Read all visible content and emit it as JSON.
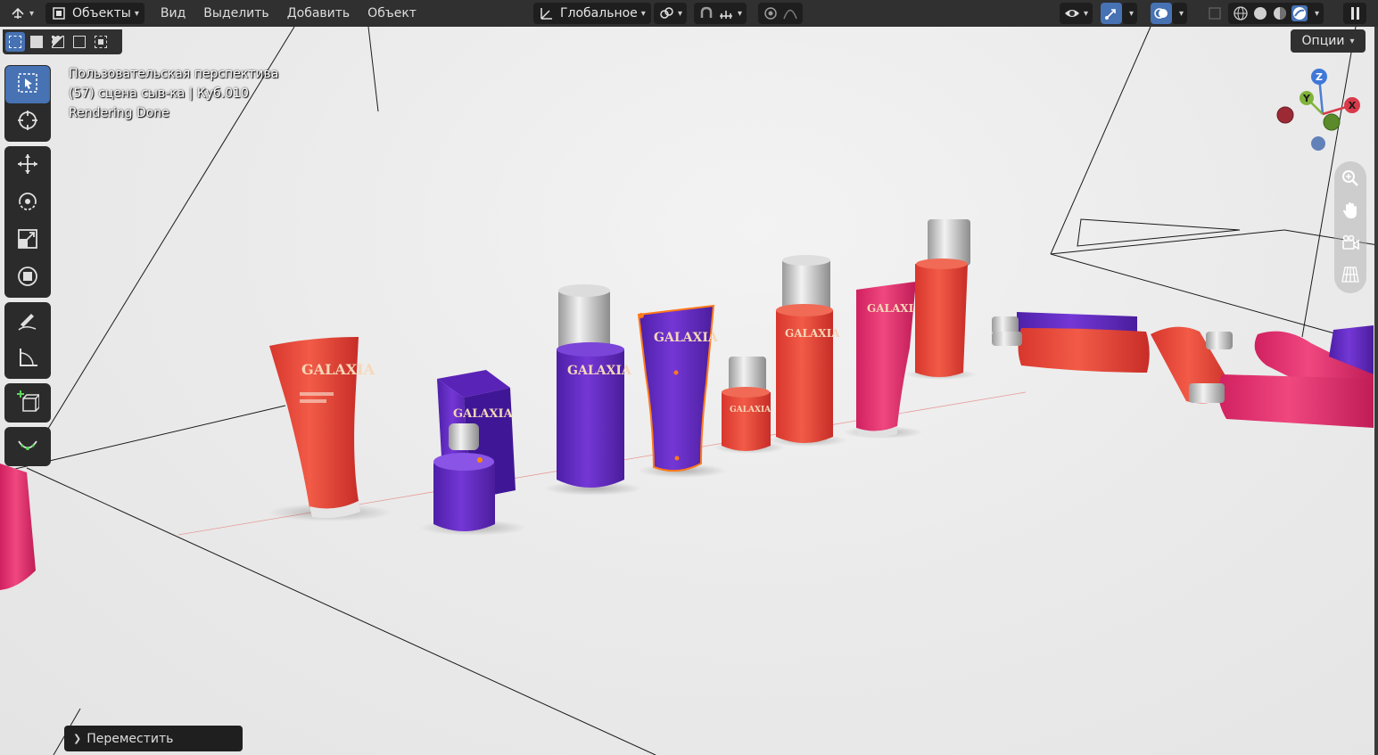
{
  "header": {
    "editor_type_icon": "editor-type-icon",
    "mode_label": "Объекты",
    "menu": [
      "Вид",
      "Выделить",
      "Добавить",
      "Объект"
    ],
    "transform_orientation": "Глобальное",
    "pivot_icon": "pivot-point-icon",
    "snap_icon": "snap-magnet-icon",
    "proportional_icon": "proportional-edit-icon"
  },
  "overlay": {
    "view_name": "Пользовательская перспектива",
    "object_info": "(57) сцена сыв-ка | Куб.010",
    "status": "Rendering Done"
  },
  "options_label": "Опции",
  "gizmo": {
    "z": "Z",
    "y": "Y",
    "x": "X"
  },
  "operator_panel": {
    "label": "Переместить"
  },
  "products": [
    {
      "brand": "GALAXIA",
      "color": "#ef4a3e",
      "type": "tube"
    },
    {
      "brand": "GALAXIA",
      "color": "#6a2fc9",
      "type": "box"
    },
    {
      "brand": "GALAXIA",
      "color": "#6a2fc9",
      "type": "bottle"
    },
    {
      "brand": "GALAXIA",
      "color": "#6a2fc9",
      "type": "tube"
    },
    {
      "brand": "GALAXIA",
      "color": "#ef4a3e",
      "type": "jar"
    },
    {
      "brand": "GALAXIA",
      "color": "#ef4a3e",
      "type": "bottle"
    },
    {
      "brand": "GALAXIA",
      "color": "#e8336e",
      "type": "tube"
    },
    {
      "brand": "GALAXIA",
      "color": "#ef4a3e",
      "type": "bottle"
    }
  ],
  "colors": {
    "header_bg": "#303030",
    "accent": "#4772b3",
    "viewport_bg": "#e9e9e9"
  }
}
